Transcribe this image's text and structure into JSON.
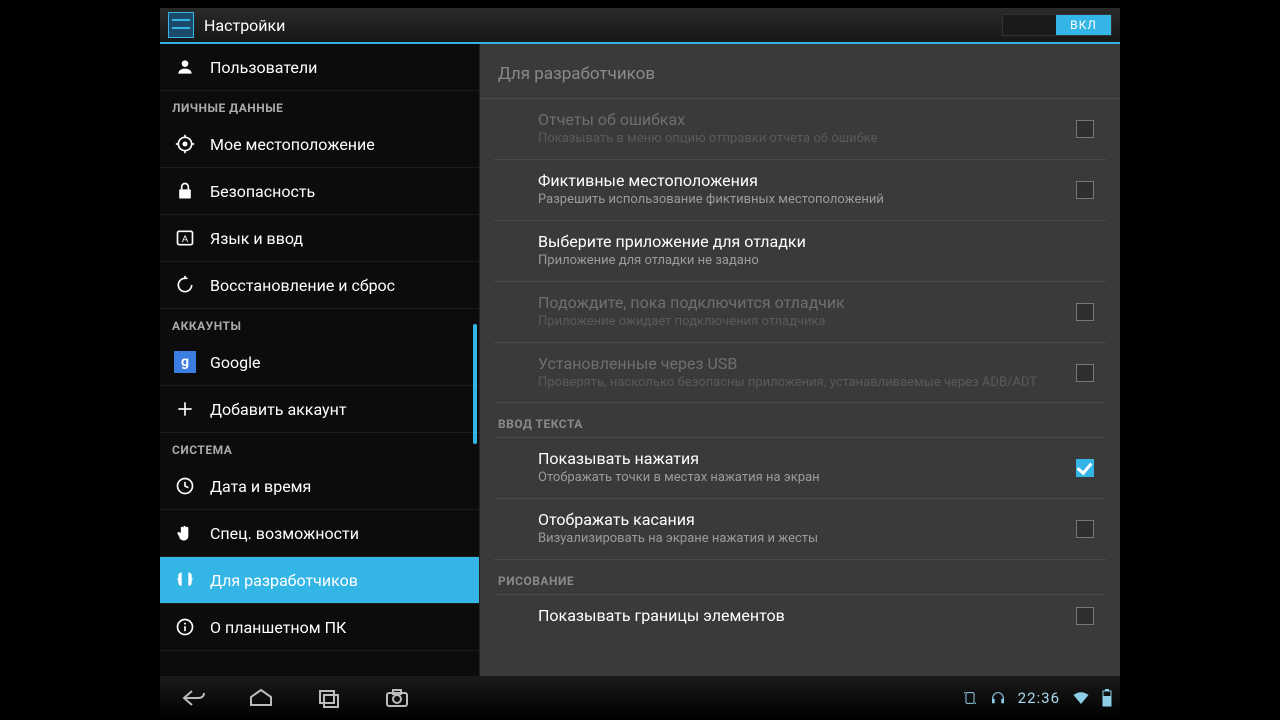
{
  "actionbar": {
    "title": "Настройки",
    "toggle_label": "ВКЛ"
  },
  "sidebar": {
    "header_personal": "ЛИЧНЫЕ ДАННЫЕ",
    "header_accounts": "АККАУНТЫ",
    "header_system": "СИСТЕМА",
    "items": {
      "users": "Пользователи",
      "location": "Мое местоположение",
      "security": "Безопасность",
      "language": "Язык и ввод",
      "backup": "Восстановление и сброс",
      "google": "Google",
      "add_account": "Добавить аккаунт",
      "datetime": "Дата и время",
      "accessibility": "Спец. возможности",
      "developer": "Для разработчиков",
      "about": "О планшетном ПК"
    }
  },
  "content": {
    "title": "Для разработчиков",
    "cat_input": "ВВОД ТЕКСТА",
    "cat_drawing": "РИСОВАНИЕ",
    "prefs": {
      "bug_reports": {
        "title": "Отчеты об ошибках",
        "sub": "Показывать в меню опцию отправки отчета об ошибке"
      },
      "mock_locations": {
        "title": "Фиктивные местоположения",
        "sub": "Разрешить использование фиктивных местоположений"
      },
      "debug_app": {
        "title": "Выберите приложение для отладки",
        "sub": "Приложение для отладки не задано"
      },
      "wait_debugger": {
        "title": "Подождите, пока подключится отладчик",
        "sub": "Приложение ожидает подключения отладчика"
      },
      "verify_usb": {
        "title": "Установленные через USB",
        "sub": "Проверять, насколько безопасны приложения, устанавливаемые через ADB/ADT"
      },
      "show_touches": {
        "title": "Показывать нажатия",
        "sub": "Отображать точки в местах нажатия на экран"
      },
      "pointer_location": {
        "title": "Отображать касания",
        "sub": "Визуализировать на экране нажатия и жесты"
      },
      "layout_bounds": {
        "title": "Показывать границы элементов"
      }
    }
  },
  "statusbar": {
    "time": "22:36"
  }
}
